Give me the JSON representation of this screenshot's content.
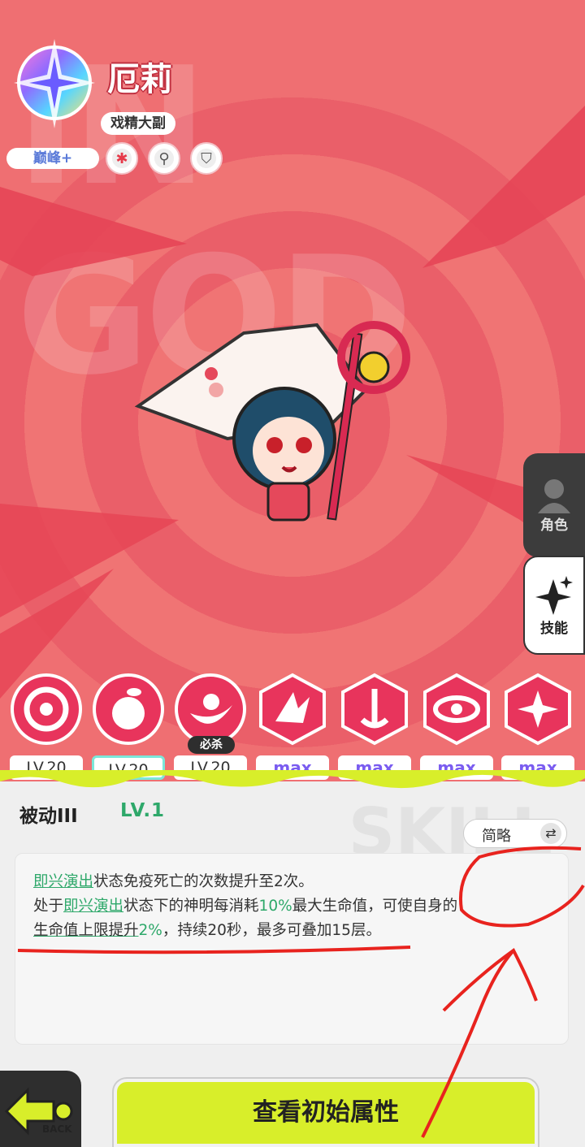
{
  "character": {
    "name": "厄莉",
    "title": "戏精大副",
    "rank": "巅峰+",
    "badges": [
      "red-flower-icon",
      "magnifier-icon",
      "shield-icon"
    ]
  },
  "background": {
    "watermark": "IN GOD"
  },
  "side_tabs": [
    {
      "label": "角色",
      "icon": "person-icon"
    },
    {
      "label": "技能",
      "icon": "sparkle-icon"
    }
  ],
  "skills": [
    {
      "icon": "sun-wheel-skill-icon",
      "level": "LV.20"
    },
    {
      "icon": "peach-skill-icon",
      "level": "LV.20"
    },
    {
      "icon": "crescent-skill-icon",
      "level": "LV.20",
      "tag": "必杀"
    },
    {
      "icon": "splash-skill-icon",
      "level": "max"
    },
    {
      "icon": "anchor-skill-icon",
      "level": "max"
    },
    {
      "icon": "vortex-skill-icon",
      "level": "max"
    },
    {
      "icon": "star-spin-skill-icon",
      "level": "max"
    }
  ],
  "detail": {
    "watermark": "SKILL",
    "skill_name": "被动III",
    "skill_level": "LV.1",
    "toggle_label": "简略",
    "desc": {
      "l1_kw": "即兴演出",
      "l1_rest": "状态免疫死亡的次数提升至2次。",
      "l2_pre": "处于",
      "l2_kw": "即兴演出",
      "l2_mid": "状态下的神明每消耗",
      "l2_num": "10%",
      "l2_rest": "最大生命值，可使自身的",
      "l3_kw": "生命值上限提升",
      "l3_num": "2%",
      "l3_rest": "，持续20秒，最多可叠加15层。"
    }
  },
  "footer": {
    "back_label": "BACK",
    "main_button": "查看初始属性"
  },
  "colors": {
    "hero_bg": "#ef6f72",
    "accent_green": "#2ea86a",
    "button_yellow": "#d8ee2a",
    "annotation_red": "#e8231e"
  }
}
